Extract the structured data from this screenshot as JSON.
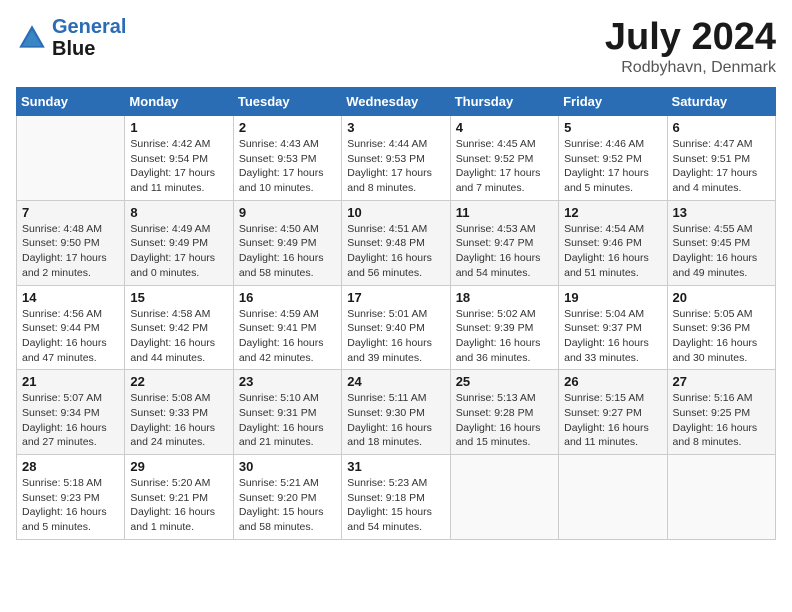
{
  "header": {
    "logo_line1": "General",
    "logo_line2": "Blue",
    "month": "July 2024",
    "location": "Rodbyhavn, Denmark"
  },
  "weekdays": [
    "Sunday",
    "Monday",
    "Tuesday",
    "Wednesday",
    "Thursday",
    "Friday",
    "Saturday"
  ],
  "weeks": [
    [
      {
        "day": "",
        "sunrise": "",
        "sunset": "",
        "daylight": ""
      },
      {
        "day": "1",
        "sunrise": "Sunrise: 4:42 AM",
        "sunset": "Sunset: 9:54 PM",
        "daylight": "Daylight: 17 hours and 11 minutes."
      },
      {
        "day": "2",
        "sunrise": "Sunrise: 4:43 AM",
        "sunset": "Sunset: 9:53 PM",
        "daylight": "Daylight: 17 hours and 10 minutes."
      },
      {
        "day": "3",
        "sunrise": "Sunrise: 4:44 AM",
        "sunset": "Sunset: 9:53 PM",
        "daylight": "Daylight: 17 hours and 8 minutes."
      },
      {
        "day": "4",
        "sunrise": "Sunrise: 4:45 AM",
        "sunset": "Sunset: 9:52 PM",
        "daylight": "Daylight: 17 hours and 7 minutes."
      },
      {
        "day": "5",
        "sunrise": "Sunrise: 4:46 AM",
        "sunset": "Sunset: 9:52 PM",
        "daylight": "Daylight: 17 hours and 5 minutes."
      },
      {
        "day": "6",
        "sunrise": "Sunrise: 4:47 AM",
        "sunset": "Sunset: 9:51 PM",
        "daylight": "Daylight: 17 hours and 4 minutes."
      }
    ],
    [
      {
        "day": "7",
        "sunrise": "Sunrise: 4:48 AM",
        "sunset": "Sunset: 9:50 PM",
        "daylight": "Daylight: 17 hours and 2 minutes."
      },
      {
        "day": "8",
        "sunrise": "Sunrise: 4:49 AM",
        "sunset": "Sunset: 9:49 PM",
        "daylight": "Daylight: 17 hours and 0 minutes."
      },
      {
        "day": "9",
        "sunrise": "Sunrise: 4:50 AM",
        "sunset": "Sunset: 9:49 PM",
        "daylight": "Daylight: 16 hours and 58 minutes."
      },
      {
        "day": "10",
        "sunrise": "Sunrise: 4:51 AM",
        "sunset": "Sunset: 9:48 PM",
        "daylight": "Daylight: 16 hours and 56 minutes."
      },
      {
        "day": "11",
        "sunrise": "Sunrise: 4:53 AM",
        "sunset": "Sunset: 9:47 PM",
        "daylight": "Daylight: 16 hours and 54 minutes."
      },
      {
        "day": "12",
        "sunrise": "Sunrise: 4:54 AM",
        "sunset": "Sunset: 9:46 PM",
        "daylight": "Daylight: 16 hours and 51 minutes."
      },
      {
        "day": "13",
        "sunrise": "Sunrise: 4:55 AM",
        "sunset": "Sunset: 9:45 PM",
        "daylight": "Daylight: 16 hours and 49 minutes."
      }
    ],
    [
      {
        "day": "14",
        "sunrise": "Sunrise: 4:56 AM",
        "sunset": "Sunset: 9:44 PM",
        "daylight": "Daylight: 16 hours and 47 minutes."
      },
      {
        "day": "15",
        "sunrise": "Sunrise: 4:58 AM",
        "sunset": "Sunset: 9:42 PM",
        "daylight": "Daylight: 16 hours and 44 minutes."
      },
      {
        "day": "16",
        "sunrise": "Sunrise: 4:59 AM",
        "sunset": "Sunset: 9:41 PM",
        "daylight": "Daylight: 16 hours and 42 minutes."
      },
      {
        "day": "17",
        "sunrise": "Sunrise: 5:01 AM",
        "sunset": "Sunset: 9:40 PM",
        "daylight": "Daylight: 16 hours and 39 minutes."
      },
      {
        "day": "18",
        "sunrise": "Sunrise: 5:02 AM",
        "sunset": "Sunset: 9:39 PM",
        "daylight": "Daylight: 16 hours and 36 minutes."
      },
      {
        "day": "19",
        "sunrise": "Sunrise: 5:04 AM",
        "sunset": "Sunset: 9:37 PM",
        "daylight": "Daylight: 16 hours and 33 minutes."
      },
      {
        "day": "20",
        "sunrise": "Sunrise: 5:05 AM",
        "sunset": "Sunset: 9:36 PM",
        "daylight": "Daylight: 16 hours and 30 minutes."
      }
    ],
    [
      {
        "day": "21",
        "sunrise": "Sunrise: 5:07 AM",
        "sunset": "Sunset: 9:34 PM",
        "daylight": "Daylight: 16 hours and 27 minutes."
      },
      {
        "day": "22",
        "sunrise": "Sunrise: 5:08 AM",
        "sunset": "Sunset: 9:33 PM",
        "daylight": "Daylight: 16 hours and 24 minutes."
      },
      {
        "day": "23",
        "sunrise": "Sunrise: 5:10 AM",
        "sunset": "Sunset: 9:31 PM",
        "daylight": "Daylight: 16 hours and 21 minutes."
      },
      {
        "day": "24",
        "sunrise": "Sunrise: 5:11 AM",
        "sunset": "Sunset: 9:30 PM",
        "daylight": "Daylight: 16 hours and 18 minutes."
      },
      {
        "day": "25",
        "sunrise": "Sunrise: 5:13 AM",
        "sunset": "Sunset: 9:28 PM",
        "daylight": "Daylight: 16 hours and 15 minutes."
      },
      {
        "day": "26",
        "sunrise": "Sunrise: 5:15 AM",
        "sunset": "Sunset: 9:27 PM",
        "daylight": "Daylight: 16 hours and 11 minutes."
      },
      {
        "day": "27",
        "sunrise": "Sunrise: 5:16 AM",
        "sunset": "Sunset: 9:25 PM",
        "daylight": "Daylight: 16 hours and 8 minutes."
      }
    ],
    [
      {
        "day": "28",
        "sunrise": "Sunrise: 5:18 AM",
        "sunset": "Sunset: 9:23 PM",
        "daylight": "Daylight: 16 hours and 5 minutes."
      },
      {
        "day": "29",
        "sunrise": "Sunrise: 5:20 AM",
        "sunset": "Sunset: 9:21 PM",
        "daylight": "Daylight: 16 hours and 1 minute."
      },
      {
        "day": "30",
        "sunrise": "Sunrise: 5:21 AM",
        "sunset": "Sunset: 9:20 PM",
        "daylight": "Daylight: 15 hours and 58 minutes."
      },
      {
        "day": "31",
        "sunrise": "Sunrise: 5:23 AM",
        "sunset": "Sunset: 9:18 PM",
        "daylight": "Daylight: 15 hours and 54 minutes."
      },
      {
        "day": "",
        "sunrise": "",
        "sunset": "",
        "daylight": ""
      },
      {
        "day": "",
        "sunrise": "",
        "sunset": "",
        "daylight": ""
      },
      {
        "day": "",
        "sunrise": "",
        "sunset": "",
        "daylight": ""
      }
    ]
  ]
}
